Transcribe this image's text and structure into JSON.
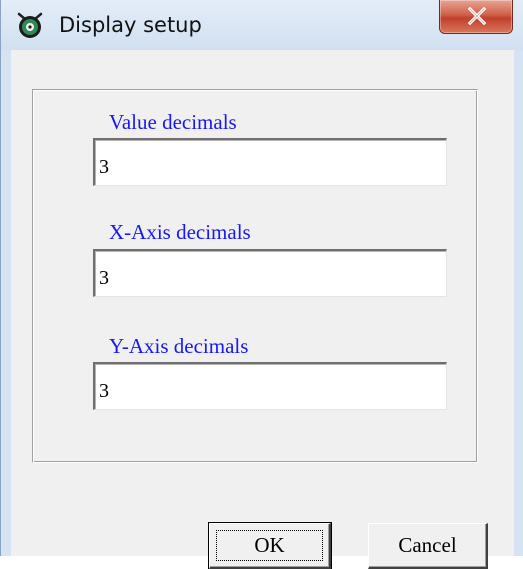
{
  "window": {
    "title": "Display setup",
    "icon": "app-gear-icon",
    "close_icon": "close-icon"
  },
  "fields": [
    {
      "label": "Value decimals",
      "value": "3"
    },
    {
      "label": "X-Axis decimals",
      "value": "3"
    },
    {
      "label": "Y-Axis decimals",
      "value": "3"
    }
  ],
  "buttons": {
    "ok": "OK",
    "cancel": "Cancel"
  },
  "colors": {
    "label_blue": "#1818f0",
    "close_red": "#c1402b"
  }
}
